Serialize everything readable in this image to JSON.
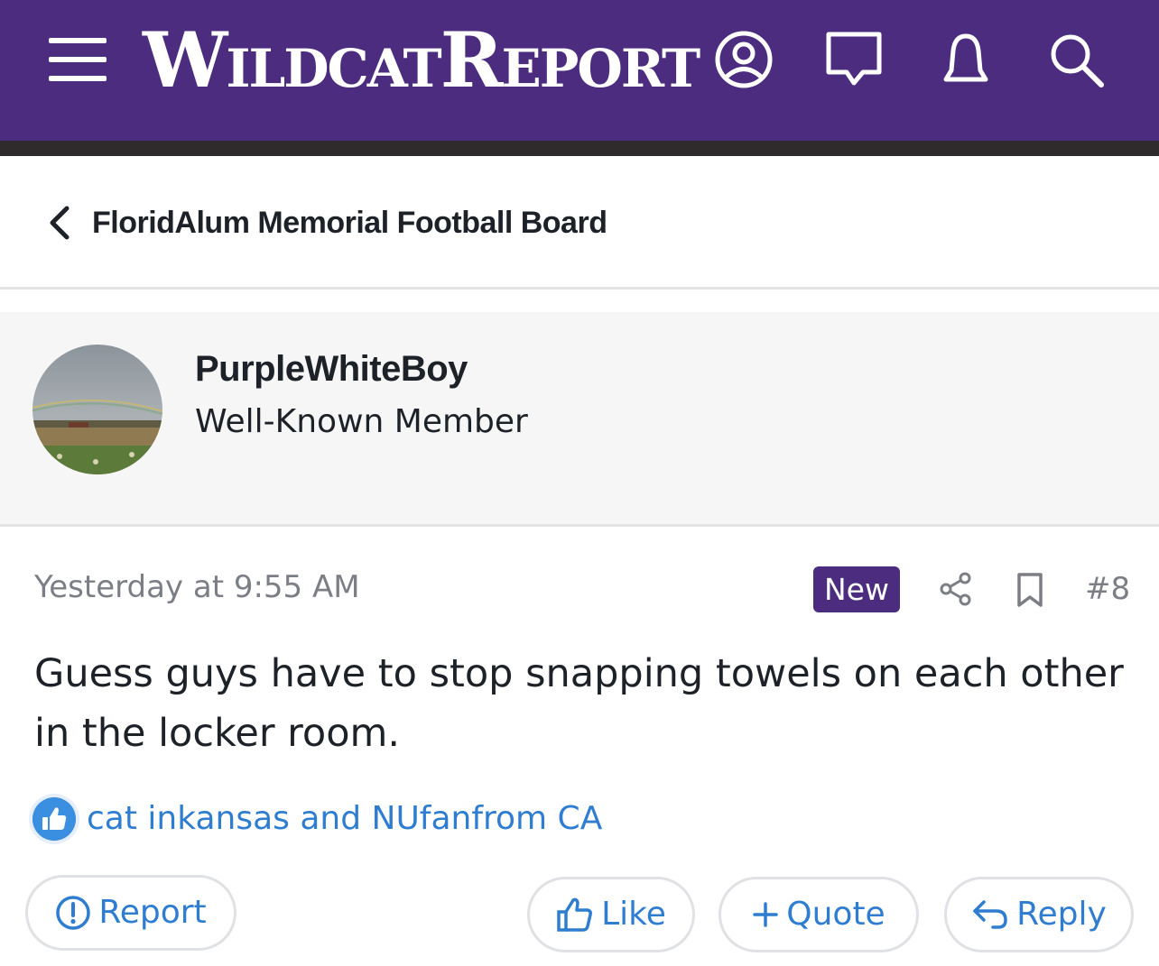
{
  "header": {
    "logo_w": "W",
    "logo_ildcat": "ILDCAT",
    "logo_r": "R",
    "logo_eport": "EPORT",
    "icons": [
      "hamburger-icon",
      "account-icon",
      "messages-icon",
      "alerts-icon",
      "search-icon"
    ],
    "brand_color": "#4b2c7f"
  },
  "breadcrumb": {
    "label": "FloridAlum Memorial Football Board"
  },
  "post": {
    "author": "PurpleWhiteBoy",
    "author_title": "Well-Known Member",
    "timestamp": "Yesterday at 9:55 AM",
    "badge": "New",
    "number": "#8",
    "body": "Guess guys have to stop snapping towels on each other in the locker room.",
    "likes_text": "cat inkansas and NUfanfrom CA"
  },
  "actions": {
    "report": "Report",
    "like": "Like",
    "quote": "Quote",
    "reply": "Reply"
  },
  "colors": {
    "link": "#2f7dd1",
    "muted": "#7b7f85",
    "text": "#1d2229"
  }
}
